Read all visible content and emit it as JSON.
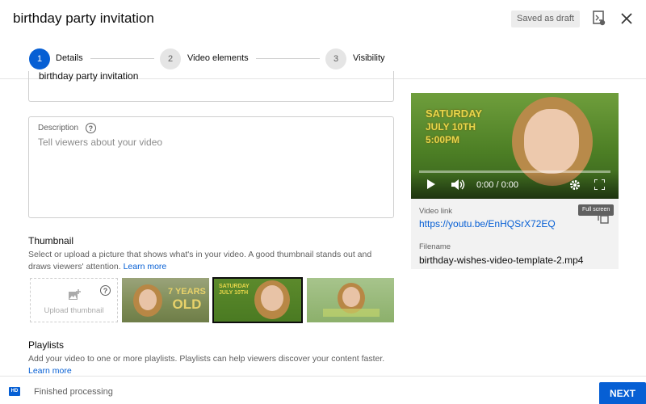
{
  "header": {
    "title": "birthday party invitation",
    "draft_status": "Saved as draft"
  },
  "stepper": {
    "steps": [
      {
        "number": "1",
        "label": "Details"
      },
      {
        "number": "2",
        "label": "Video elements"
      },
      {
        "number": "3",
        "label": "Visibility"
      }
    ]
  },
  "details": {
    "title_value": "birthday party invitation",
    "description_label": "Description",
    "description_placeholder": "Tell viewers about your video",
    "thumbnail_title": "Thumbnail",
    "thumbnail_desc": "Select or upload a picture that shows what's in your video. A good thumbnail stands out and draws viewers' attention.",
    "thumbnail_link": "Learn more",
    "upload_thumbnail_label": "Upload thumbnail",
    "thumbnail_1_text_top": "7 YEARS",
    "thumbnail_1_text_bottom": "OLD",
    "thumbnail_2_text_top": "SATURDAY",
    "thumbnail_2_text_bottom": "JULY 10TH",
    "playlists_title": "Playlists",
    "playlists_desc": "Add your video to one or more playlists. Playlists can help viewers discover your content faster.",
    "playlists_link": "Learn more"
  },
  "video": {
    "overlay_line1": "SATURDAY",
    "overlay_line2": "JULY 10TH",
    "overlay_line3": "5:00PM",
    "time": "0:00 / 0:00",
    "tooltip": "Full screen",
    "link_label": "Video link",
    "link": "https://youtu.be/EnHQSrX72EQ",
    "filename_label": "Filename",
    "filename": "birthday-wishes-video-template-2.mp4"
  },
  "footer": {
    "hd_badge": "HD",
    "status": "Finished processing",
    "next_label": "NEXT"
  },
  "colors": {
    "accent": "#065fd4",
    "text_secondary": "#606060"
  }
}
